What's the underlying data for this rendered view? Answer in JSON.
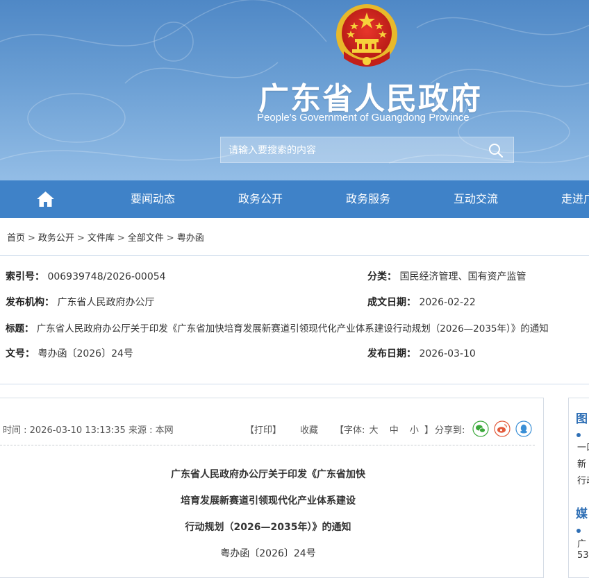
{
  "header": {
    "title": "广东省人民政府",
    "subtitle": "People's Government of Guangdong Province",
    "search_placeholder": "请输入要搜索的内容",
    "icons": {
      "emblem": "national-emblem",
      "search": "search-icon"
    }
  },
  "nav": {
    "home_icon": "home-icon",
    "items": [
      "要闻动态",
      "政务公开",
      "政务服务",
      "互动交流",
      "走进广"
    ]
  },
  "breadcrumb": [
    "首页",
    "政务公开",
    "文件库",
    "全部文件",
    "粤办函"
  ],
  "breadcrumb_sep": ">",
  "meta": {
    "index_label": "索引号：",
    "index_value": "006939748/2026-00054",
    "category_label": "分类：",
    "category_value": "国民经济管理、国有资产监管",
    "issuer_label": "发布机构：",
    "issuer_value": "广东省人民政府办公厅",
    "date_written_label": "成文日期：",
    "date_written_value": "2026-02-22",
    "title_label": "标题：",
    "title_value": "广东省人民政府办公厅关于印发《广东省加快培育发展新赛道引领现代化产业体系建设行动规划（2026—2035年）》的通知",
    "docno_label": "文号：",
    "docno_value": "粤办函〔2026〕24号",
    "pub_date_label": "发布日期：",
    "pub_date_value": "2026-03-10"
  },
  "article": {
    "time": "时间 : 2026-03-10 13:13:35",
    "source": "来源 : 本网",
    "print": "【打印】",
    "favorite": "收藏",
    "font_prefix": "【字体:",
    "font_large": "大",
    "font_medium": "中",
    "font_small": "小",
    "font_suffix": "】",
    "share_label": "分享到:",
    "share_icons": [
      "wechat-icon",
      "weibo-icon",
      "qq-icon"
    ],
    "share_colors": [
      "#3aa83a",
      "#e25a3b",
      "#3a8fd6"
    ],
    "title_lines": [
      "广东省人民政府办公厅关于印发《广东省加快",
      "培育发展新赛道引领现代化产业体系建设",
      "行动规划（2026—2035年）》的通知"
    ],
    "doc_no": "粤办函〔2026〕24号"
  },
  "sidebar": {
    "head1": "图",
    "lines1": [
      "一口",
      "新",
      "行动"
    ],
    "head2": "媒",
    "lines2": [
      "广",
      "53"
    ]
  },
  "colors": {
    "nav_bg": "#3f82c8",
    "accent": "#2f6fb5"
  }
}
